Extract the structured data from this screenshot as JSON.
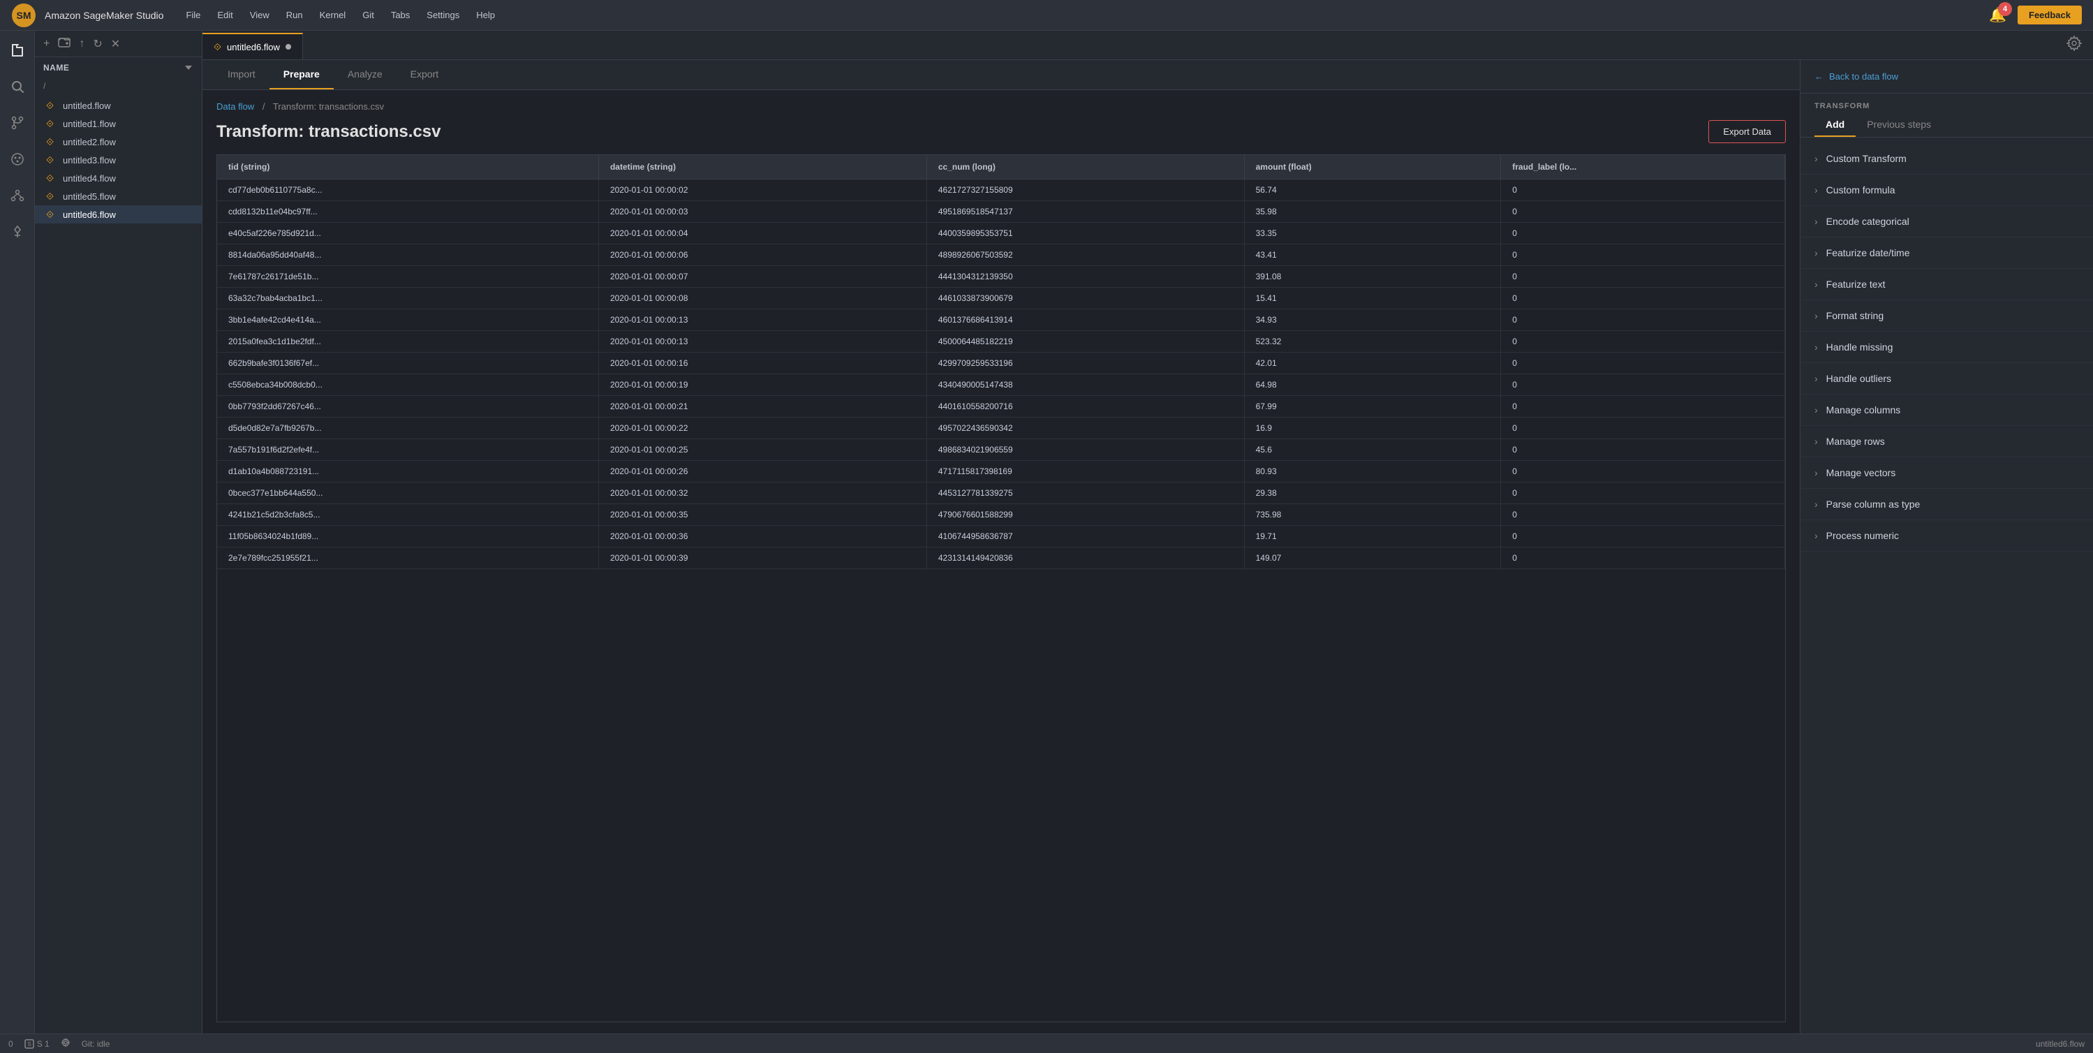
{
  "app": {
    "name": "Amazon SageMaker Studio",
    "feedback_label": "Feedback"
  },
  "menu": {
    "items": [
      "File",
      "Edit",
      "View",
      "Run",
      "Kernel",
      "Git",
      "Tabs",
      "Settings",
      "Help"
    ]
  },
  "notification": {
    "count": "4"
  },
  "tab": {
    "label": "untitled6.flow"
  },
  "sub_tabs": {
    "items": [
      "Import",
      "Prepare",
      "Analyze",
      "Export"
    ],
    "active": "Prepare"
  },
  "breadcrumb": {
    "link": "Data flow",
    "sep": "/",
    "current": "Transform: transactions.csv"
  },
  "transform_view": {
    "title": "Transform: transactions.csv",
    "export_btn": "Export Data"
  },
  "table": {
    "columns": [
      "tid (string)",
      "datetime (string)",
      "cc_num (long)",
      "amount (float)",
      "fraud_label (lo..."
    ],
    "rows": [
      [
        "cd77deb0b6110775a8c...",
        "2020-01-01 00:00:02",
        "4621727327155809",
        "56.74",
        "0"
      ],
      [
        "cdd8132b11e04bc97ff...",
        "2020-01-01 00:00:03",
        "4951869518547137",
        "35.98",
        "0"
      ],
      [
        "e40c5af226e785d921d...",
        "2020-01-01 00:00:04",
        "4400359895353751",
        "33.35",
        "0"
      ],
      [
        "8814da06a95dd40af48...",
        "2020-01-01 00:00:06",
        "4898926067503592",
        "43.41",
        "0"
      ],
      [
        "7e61787c26171de51b...",
        "2020-01-01 00:00:07",
        "4441304312139350",
        "391.08",
        "0"
      ],
      [
        "63a32c7bab4acba1bc1...",
        "2020-01-01 00:00:08",
        "4461033873900679",
        "15.41",
        "0"
      ],
      [
        "3bb1e4afe42cd4e414a...",
        "2020-01-01 00:00:13",
        "4601376686413914",
        "34.93",
        "0"
      ],
      [
        "2015a0fea3c1d1be2fdf...",
        "2020-01-01 00:00:13",
        "4500064485182219",
        "523.32",
        "0"
      ],
      [
        "662b9bafe3f0136f67ef...",
        "2020-01-01 00:00:16",
        "4299709259533196",
        "42.01",
        "0"
      ],
      [
        "c5508ebca34b008dcb0...",
        "2020-01-01 00:00:19",
        "4340490005147438",
        "64.98",
        "0"
      ],
      [
        "0bb7793f2dd67267c46...",
        "2020-01-01 00:00:21",
        "4401610558200716",
        "67.99",
        "0"
      ],
      [
        "d5de0d82e7a7fb9267b...",
        "2020-01-01 00:00:22",
        "4957022436590342",
        "16.9",
        "0"
      ],
      [
        "7a557b191f6d2f2efe4f...",
        "2020-01-01 00:00:25",
        "4986834021906559",
        "45.6",
        "0"
      ],
      [
        "d1ab10a4b088723191...",
        "2020-01-01 00:00:26",
        "4717115817398169",
        "80.93",
        "0"
      ],
      [
        "0bcec377e1bb644a550...",
        "2020-01-01 00:00:32",
        "4453127781339275",
        "29.38",
        "0"
      ],
      [
        "4241b21c5d2b3cfa8c5...",
        "2020-01-01 00:00:35",
        "4790676601588299",
        "735.98",
        "0"
      ],
      [
        "11f05b8634024b1fd89...",
        "2020-01-01 00:00:36",
        "4106744958636787",
        "19.71",
        "0"
      ],
      [
        "2e7e789fcc251955f21...",
        "2020-01-01 00:00:39",
        "4231314149420836",
        "149.07",
        "0"
      ]
    ]
  },
  "right_panel": {
    "back_label": "Back to data flow",
    "section_label": "TRANSFORM",
    "tabs": [
      "Add",
      "Previous steps"
    ],
    "active_tab": "Add",
    "transforms": [
      "Custom Transform",
      "Custom formula",
      "Encode categorical",
      "Featurize date/time",
      "Featurize text",
      "Format string",
      "Handle missing",
      "Handle outliers",
      "Manage columns",
      "Manage rows",
      "Manage vectors",
      "Parse column as type",
      "Process numeric"
    ]
  },
  "sidebar": {
    "section_label": "Name",
    "path": "/ ",
    "files": [
      "untitled.flow",
      "untitled1.flow",
      "untitled2.flow",
      "untitled3.flow",
      "untitled4.flow",
      "untitled5.flow",
      "untitled6.flow"
    ]
  },
  "status_bar": {
    "items": [
      "0",
      "S 1"
    ],
    "git": "Git: idle",
    "right": "untitled6.flow"
  }
}
